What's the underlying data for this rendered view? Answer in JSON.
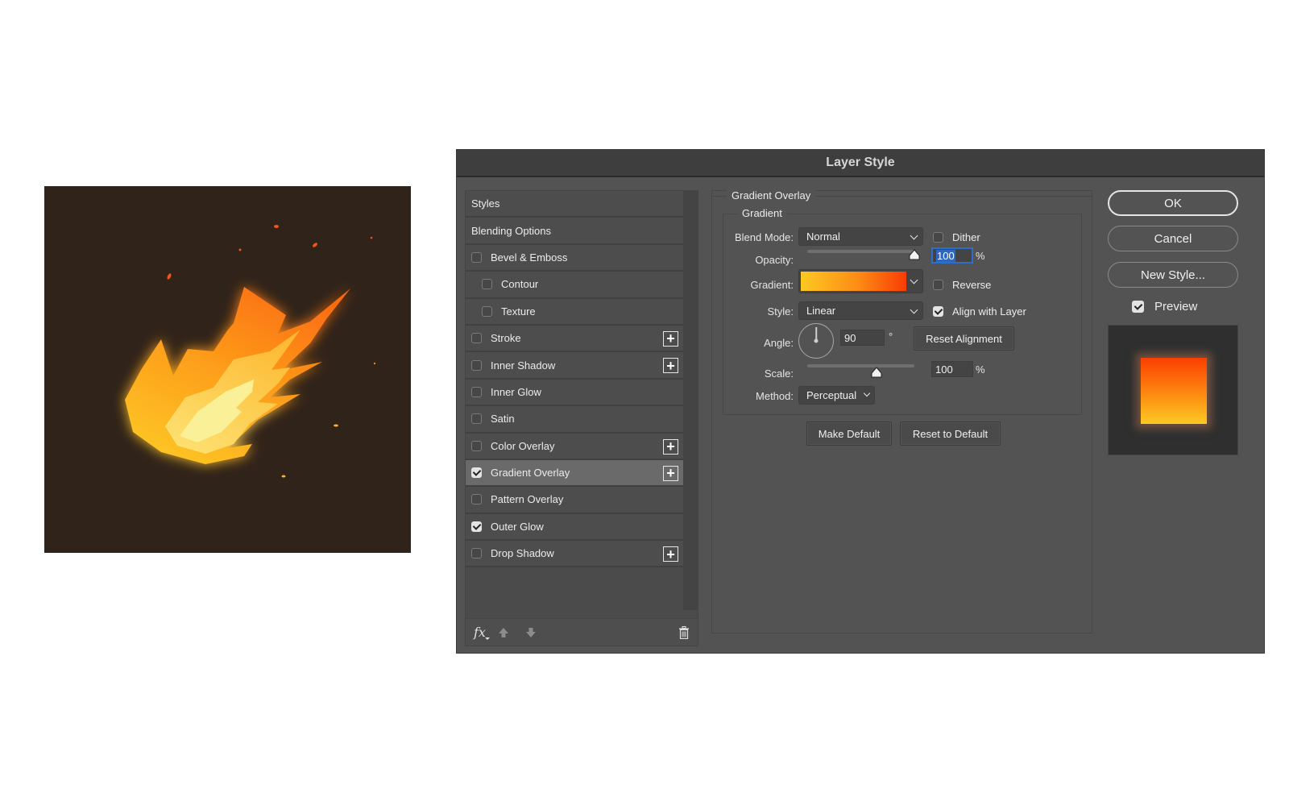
{
  "artwork": {
    "subject": "fireball",
    "background_color": "#30231a"
  },
  "dialog": {
    "title": "Layer Style",
    "styles_list": {
      "header": "Styles",
      "blending_options": "Blending Options",
      "items": [
        {
          "label": "Bevel & Emboss",
          "checked": false,
          "indent": false,
          "has_add": false,
          "selected": false
        },
        {
          "label": "Contour",
          "checked": false,
          "indent": true,
          "has_add": false,
          "selected": false
        },
        {
          "label": "Texture",
          "checked": false,
          "indent": true,
          "has_add": false,
          "selected": false
        },
        {
          "label": "Stroke",
          "checked": false,
          "indent": false,
          "has_add": true,
          "selected": false
        },
        {
          "label": "Inner Shadow",
          "checked": false,
          "indent": false,
          "has_add": true,
          "selected": false
        },
        {
          "label": "Inner Glow",
          "checked": false,
          "indent": false,
          "has_add": false,
          "selected": false
        },
        {
          "label": "Satin",
          "checked": false,
          "indent": false,
          "has_add": false,
          "selected": false
        },
        {
          "label": "Color Overlay",
          "checked": false,
          "indent": false,
          "has_add": true,
          "selected": false
        },
        {
          "label": "Gradient Overlay",
          "checked": true,
          "indent": false,
          "has_add": true,
          "selected": true
        },
        {
          "label": "Pattern Overlay",
          "checked": false,
          "indent": false,
          "has_add": false,
          "selected": false
        },
        {
          "label": "Outer Glow",
          "checked": true,
          "indent": false,
          "has_add": false,
          "selected": false
        },
        {
          "label": "Drop Shadow",
          "checked": false,
          "indent": false,
          "has_add": true,
          "selected": false
        }
      ],
      "footer": {
        "fx_label": "fx",
        "move_up": "move-up-icon",
        "move_down": "move-down-icon",
        "delete": "trash-icon"
      }
    },
    "gradient_overlay": {
      "section_title": "Gradient Overlay",
      "group_title": "Gradient",
      "blend_mode_label": "Blend Mode:",
      "blend_mode": "Normal",
      "dither_label": "Dither",
      "dither": false,
      "opacity_label": "Opacity:",
      "opacity": "100",
      "opacity_percent": 100,
      "opacity_unit": "%",
      "gradient_label": "Gradient:",
      "gradient_colors": [
        "#fdc923",
        "#fd8b14",
        "#f83c05"
      ],
      "reverse_label": "Reverse",
      "reverse": false,
      "style_label": "Style:",
      "style": "Linear",
      "align_label": "Align with Layer",
      "align_with_layer": true,
      "angle_label": "Angle:",
      "angle": "90",
      "angle_unit": "°",
      "reset_alignment": "Reset Alignment",
      "scale_label": "Scale:",
      "scale": "100",
      "scale_percent": 100,
      "scale_unit": "%",
      "method_label": "Method:",
      "method": "Perceptual",
      "make_default": "Make Default",
      "reset_to_default": "Reset to Default"
    },
    "buttons": {
      "ok": "OK",
      "cancel": "Cancel",
      "new_style": "New Style...",
      "preview_label": "Preview",
      "preview": true
    },
    "preview_gradient": [
      "#fb3e00",
      "#fd8a12",
      "#fdc922"
    ]
  }
}
